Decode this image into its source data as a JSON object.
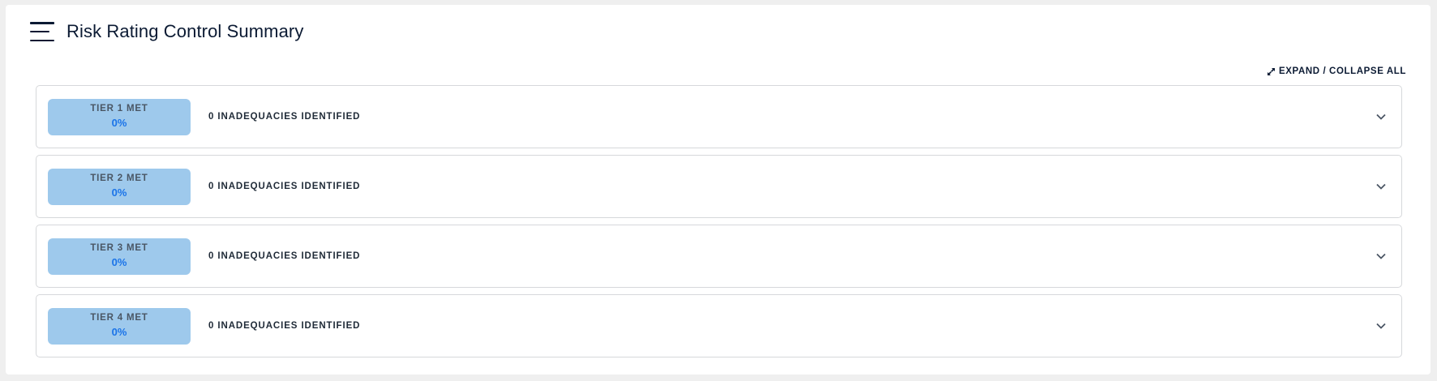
{
  "header": {
    "title": "Risk Rating Control Summary"
  },
  "toolbar": {
    "expand_collapse_label": "EXPAND / COLLAPSE ALL"
  },
  "panels": [
    {
      "tier_label": "TIER 1 MET",
      "tier_value": "0%",
      "inadequacies": "0 INADEQUACIES IDENTIFIED"
    },
    {
      "tier_label": "TIER 2 MET",
      "tier_value": "0%",
      "inadequacies": "0 INADEQUACIES IDENTIFIED"
    },
    {
      "tier_label": "TIER 3 MET",
      "tier_value": "0%",
      "inadequacies": "0 INADEQUACIES IDENTIFIED"
    },
    {
      "tier_label": "TIER 4 MET",
      "tier_value": "0%",
      "inadequacies": "0 INADEQUACIES IDENTIFIED"
    }
  ],
  "icons": {
    "menu": "hamburger-menu-icon",
    "expand": "expand-arrows-icon",
    "chevron": "chevron-down-icon"
  },
  "colors": {
    "title": "#0b1a33",
    "badge_background": "#9ec9ec",
    "badge_value": "#1a73e8",
    "panel_border": "#d6d8db"
  }
}
